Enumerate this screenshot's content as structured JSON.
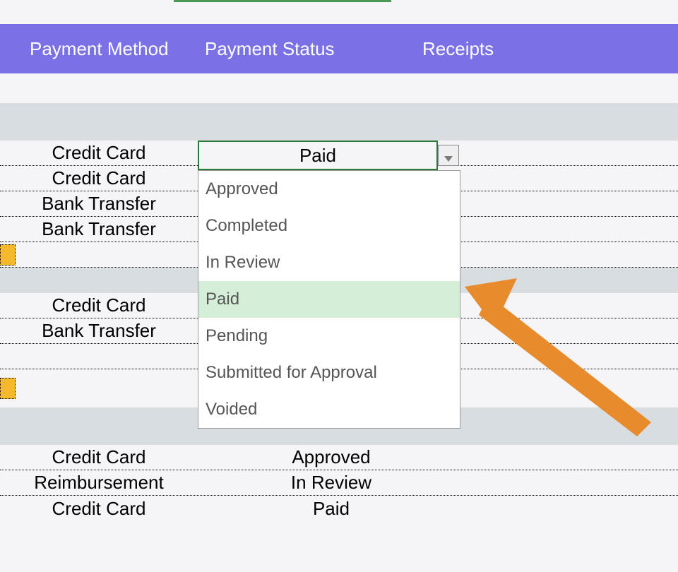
{
  "header": {
    "payment_method": "Payment Method",
    "payment_status": "Payment Status",
    "receipts": "Receipts"
  },
  "rows_top": [
    {
      "method": "Credit Card",
      "status": "Paid"
    },
    {
      "method": "Credit Card",
      "status": ""
    },
    {
      "method": "Bank Transfer",
      "status": ""
    },
    {
      "method": "Bank Transfer",
      "status": ""
    }
  ],
  "rows_mid": [
    {
      "method": "Credit Card",
      "status": ""
    },
    {
      "method": "Bank Transfer",
      "status": ""
    }
  ],
  "rows_bottom": [
    {
      "method": "Credit Card",
      "status": "Approved"
    },
    {
      "method": "Reimbursement",
      "status": "In Review"
    },
    {
      "method": "Credit Card",
      "status": "Paid"
    }
  ],
  "dropdown": {
    "selected": "Paid",
    "options": [
      "Approved",
      "Completed",
      "In Review",
      "Paid",
      "Pending",
      "Submitted for Approval",
      "Voided"
    ],
    "selected_index": 3
  },
  "colors": {
    "header_bg": "#7a71e6",
    "gray_band": "#d7dde1",
    "dropdown_border": "#2a7a3a",
    "dropdown_highlight": "#d5eed8",
    "arrow": "#e88b2c",
    "yellow": "#f6b92b"
  }
}
